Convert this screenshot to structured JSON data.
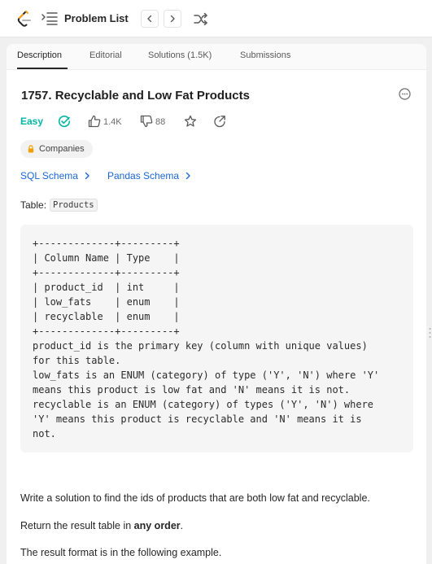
{
  "header": {
    "problem_list_label": "Problem List",
    "icons": [
      "leetcode-logo",
      "list-icon",
      "chevron-left-icon",
      "chevron-right-icon",
      "shuffle-icon"
    ]
  },
  "tabs": [
    {
      "label": "Description",
      "active": true
    },
    {
      "label": "Editorial",
      "active": false
    },
    {
      "label": "Solutions (1.5K)",
      "active": false
    },
    {
      "label": "Submissions",
      "active": false
    }
  ],
  "problem": {
    "title": "1757. Recyclable and Low Fat Products",
    "difficulty": "Easy",
    "difficulty_color": "#00b8a3",
    "likes": "1.4K",
    "dislikes": "88",
    "companies_label": "Companies"
  },
  "schemas": {
    "sql": "SQL Schema",
    "pandas": "Pandas Schema",
    "link_color": "#1a66d6"
  },
  "table": {
    "prefix": "Table:",
    "name": "Products"
  },
  "code_block": "+-------------+---------+\n| Column Name | Type    |\n+-------------+---------+\n| product_id  | int     |\n| low_fats    | enum    |\n| recyclable  | enum    |\n+-------------+---------+\nproduct_id is the primary key (column with unique values)\nfor this table.\nlow_fats is an ENUM (category) of type ('Y', 'N') where 'Y'\nmeans this product is low fat and 'N' means it is not.\nrecyclable is an ENUM (category) of types ('Y', 'N') where\n'Y' means this product is recyclable and 'N' means it is\nnot.",
  "description": {
    "p1": "Write a solution to find the ids of products that are both low fat and recyclable.",
    "p2_prefix": "Return the result table in ",
    "p2_bold": "any order",
    "p2_suffix": ".",
    "p3": "The result format is in the following example."
  }
}
